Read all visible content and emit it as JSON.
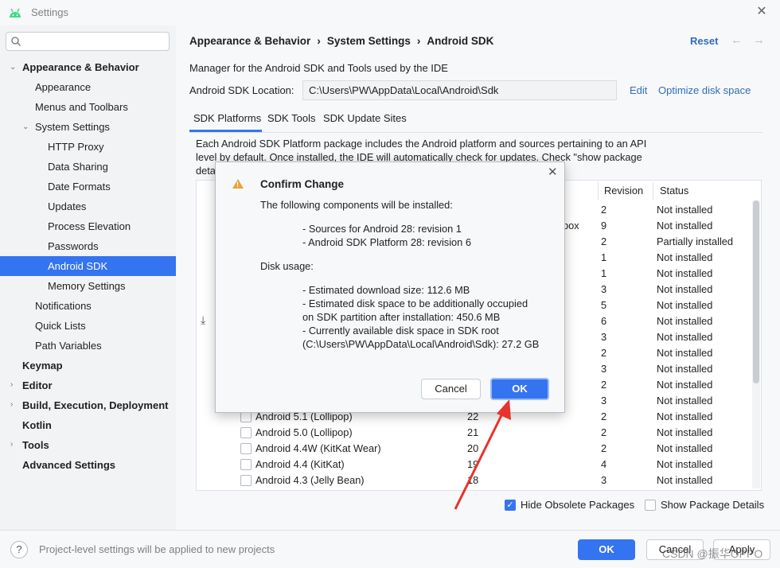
{
  "window": {
    "title": "Settings",
    "close_icon": "close-icon"
  },
  "colors": {
    "accent": "#3574f0",
    "link": "#2f6dbd",
    "warning": "#e8a33d",
    "annotation_arrow": "#e8322d"
  },
  "sidebar": {
    "search_placeholder": "",
    "items": [
      {
        "label": "Appearance & Behavior",
        "bold": true,
        "expanded": true
      },
      {
        "label": "Appearance"
      },
      {
        "label": "Menus and Toolbars"
      },
      {
        "label": "System Settings",
        "expanded": true
      },
      {
        "label": "HTTP Proxy"
      },
      {
        "label": "Data Sharing"
      },
      {
        "label": "Date Formats"
      },
      {
        "label": "Updates"
      },
      {
        "label": "Process Elevation"
      },
      {
        "label": "Passwords"
      },
      {
        "label": "Android SDK",
        "selected": true
      },
      {
        "label": "Memory Settings"
      },
      {
        "label": "Notifications"
      },
      {
        "label": "Quick Lists"
      },
      {
        "label": "Path Variables"
      },
      {
        "label": "Keymap",
        "bold": true
      },
      {
        "label": "Editor",
        "bold": true,
        "expanded": false
      },
      {
        "label": "Build, Execution, Deployment",
        "bold": true,
        "expanded": false
      },
      {
        "label": "Kotlin",
        "bold": true
      },
      {
        "label": "Tools",
        "bold": true,
        "expanded": false
      },
      {
        "label": "Advanced Settings",
        "bold": true
      }
    ]
  },
  "header": {
    "breadcrumb": [
      "Appearance & Behavior",
      "System Settings",
      "Android SDK"
    ],
    "separator": "›",
    "reset_label": "Reset"
  },
  "main": {
    "description": "Manager for the Android SDK and Tools used by the IDE",
    "location_label": "Android SDK Location:",
    "location_value": "C:\\Users\\PW\\AppData\\Local\\Android\\Sdk",
    "edit_label": "Edit",
    "optimize_label": "Optimize disk space",
    "tabs": [
      {
        "label": "SDK Platforms",
        "active": true
      },
      {
        "label": "SDK Tools"
      },
      {
        "label": "SDK Update Sites"
      }
    ],
    "platform_description_line1": "Each Android SDK Platform package includes the Android platform and sources pertaining to an API",
    "platform_description_line2": "level by default. Once installed, the IDE will automatically check for updates. Check \"show package",
    "platform_description_line3": "deta",
    "table": {
      "columns": [
        "Revision",
        "Status"
      ],
      "partial_text": "box",
      "rows": [
        {
          "revision": "2",
          "status": "Not installed"
        },
        {
          "revision": "9",
          "status": "Not installed"
        },
        {
          "revision": "2",
          "status": "Partially installed"
        },
        {
          "revision": "1",
          "status": "Not installed"
        },
        {
          "revision": "1",
          "status": "Not installed"
        },
        {
          "revision": "3",
          "status": "Not installed"
        },
        {
          "revision": "5",
          "status": "Not installed"
        },
        {
          "revision": "6",
          "status": "Not installed"
        },
        {
          "revision": "3",
          "status": "Not installed"
        },
        {
          "revision": "2",
          "status": "Not installed"
        },
        {
          "revision": "3",
          "status": "Not installed"
        },
        {
          "revision": "2",
          "status": "Not installed"
        },
        {
          "revision": "3",
          "status": "Not installed"
        },
        {
          "name": "Android 5.1 (Lollipop)",
          "api": "22",
          "revision": "2",
          "status": "Not installed"
        },
        {
          "name": "Android 5.0 (Lollipop)",
          "api": "21",
          "revision": "2",
          "status": "Not installed"
        },
        {
          "name": "Android 4.4W (KitKat Wear)",
          "api": "20",
          "revision": "2",
          "status": "Not installed"
        },
        {
          "name": "Android 4.4 (KitKat)",
          "api": "19",
          "revision": "4",
          "status": "Not installed"
        },
        {
          "name": "Android 4.3 (Jelly Bean)",
          "api": "18",
          "revision": "3",
          "status": "Not installed"
        }
      ]
    },
    "hide_obsolete_label": "Hide Obsolete Packages",
    "hide_obsolete_checked": true,
    "show_details_label": "Show Package Details",
    "show_details_checked": false
  },
  "footer": {
    "note": "Project-level settings will be applied to new projects",
    "ok_label": "OK",
    "cancel_label": "Cancel",
    "apply_label": "Apply",
    "watermark": "CSDN @振华OPPO"
  },
  "dialog": {
    "title": "Confirm Change",
    "intro": "The following components will be installed:",
    "components": [
      "- Sources for Android 28: revision 1",
      "- Android SDK Platform 28: revision 6"
    ],
    "disk_usage_label": "Disk usage:",
    "disk_lines": [
      "- Estimated download size: 112.6 MB",
      "- Estimated disk space to be additionally occupied",
      "on SDK partition after installation: 450.6 MB",
      "- Currently available disk space in SDK root",
      "(C:\\Users\\PW\\AppData\\Local\\Android\\Sdk): 27.2 GB"
    ],
    "cancel_label": "Cancel",
    "ok_label": "OK"
  }
}
